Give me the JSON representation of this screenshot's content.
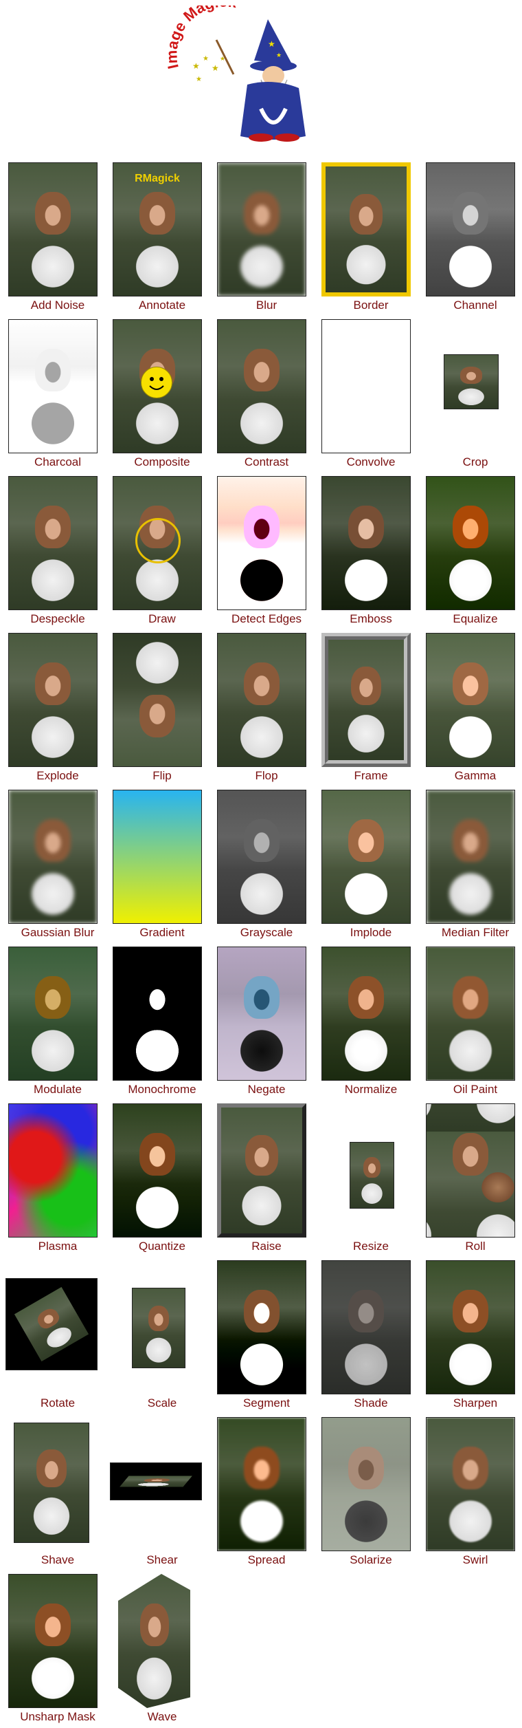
{
  "logo": {
    "text": "Image Magick"
  },
  "annotate_text": "RMagick",
  "effects": [
    "Add Noise",
    "Annotate",
    "Blur",
    "Border",
    "Channel",
    "Charcoal",
    "Composite",
    "Contrast",
    "Convolve",
    "Crop",
    "Despeckle",
    "Draw",
    "Detect Edges",
    "Emboss",
    "Equalize",
    "Explode",
    "Flip",
    "Flop",
    "Frame",
    "Gamma",
    "Gaussian Blur",
    "Gradient",
    "Grayscale",
    "Implode",
    "Median Filter",
    "Modulate",
    "Monochrome",
    "Negate",
    "Normalize",
    "Oil Paint",
    "Plasma",
    "Quantize",
    "Raise",
    "Resize",
    "Roll",
    "Rotate",
    "Scale",
    "Segment",
    "Shade",
    "Sharpen",
    "Shave",
    "Shear",
    "Spread",
    "Solarize",
    "Swirl",
    "Unsharp Mask",
    "Wave"
  ]
}
